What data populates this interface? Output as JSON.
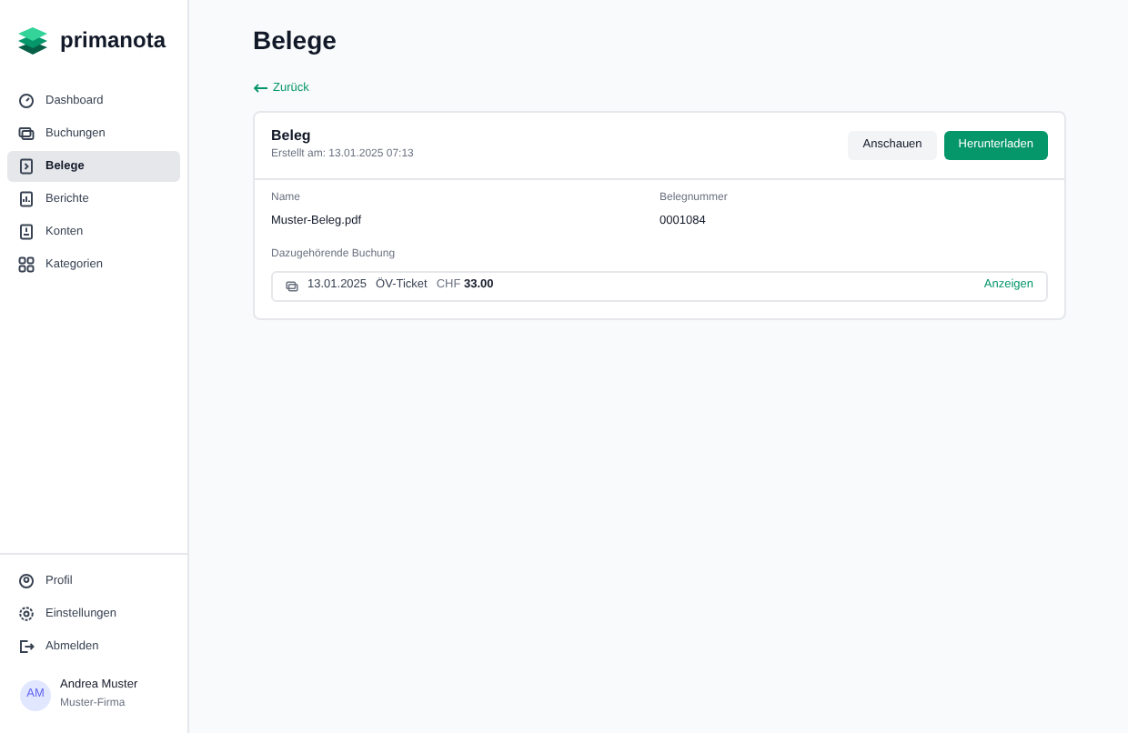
{
  "brand": "primanota",
  "nav": [
    {
      "label": "Dashboard",
      "selected": false
    },
    {
      "label": "Buchungen",
      "selected": false
    },
    {
      "label": "Belege",
      "selected": true
    },
    {
      "label": "Berichte",
      "selected": false
    },
    {
      "label": "Konten",
      "selected": false
    },
    {
      "label": "Kategorien",
      "selected": false
    }
  ],
  "bottom_nav": [
    {
      "label": "Profil"
    },
    {
      "label": "Einstellungen"
    },
    {
      "label": "Abmelden"
    }
  ],
  "user": {
    "initials": "AM",
    "name": "Andrea Muster",
    "company": "Muster-Firma"
  },
  "page_title": "Belege",
  "back_link": "Zurück",
  "card": {
    "title": "Beleg",
    "created": "Erstellt am: 13.01.2025 07:13",
    "buttons": [
      {
        "label": "Anschauen",
        "kind": "secondary"
      },
      {
        "label": "Herunterladen",
        "kind": "primary"
      }
    ],
    "fields": [
      {
        "label": "Name",
        "value": "Muster-Beleg.pdf"
      },
      {
        "label": "Belegnummer",
        "value": "0001084"
      }
    ],
    "booking_label": "Dazugehörende Buchung",
    "booking": {
      "date": "13.01.2025",
      "description": "ÖV-Ticket",
      "currency": "CHF",
      "amount": "33.00",
      "action": "Anzeigen"
    }
  }
}
